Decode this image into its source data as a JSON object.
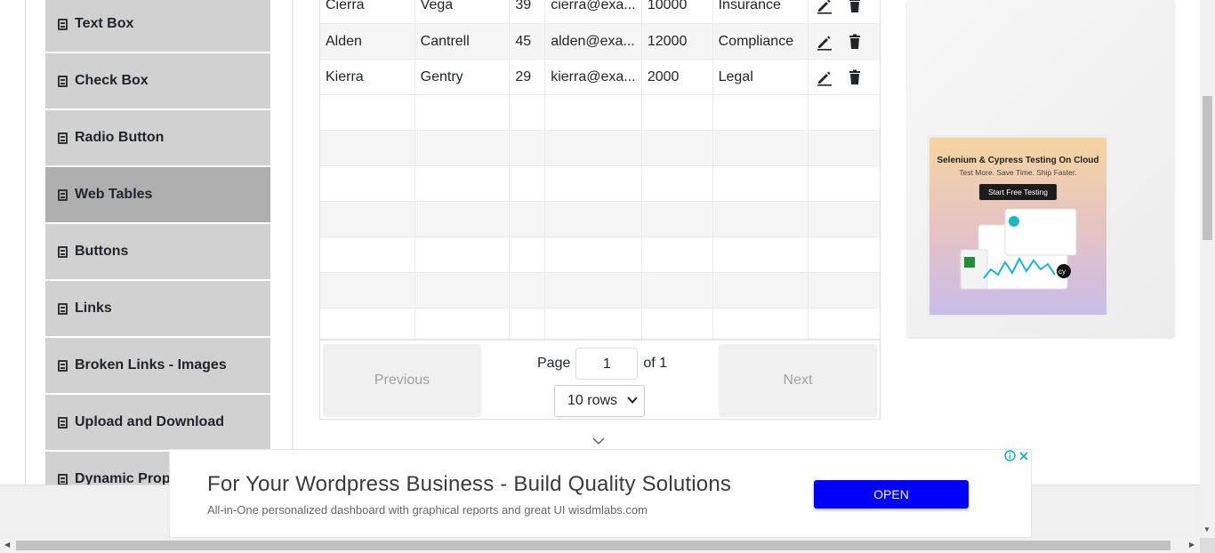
{
  "sidebar": {
    "items": [
      {
        "label": "Text Box"
      },
      {
        "label": "Check Box"
      },
      {
        "label": "Radio Button"
      },
      {
        "label": "Web Tables",
        "active": true
      },
      {
        "label": "Buttons"
      },
      {
        "label": "Links"
      },
      {
        "label": "Broken Links - Images"
      },
      {
        "label": "Upload and Download"
      },
      {
        "label": "Dynamic Prop"
      }
    ]
  },
  "table": {
    "rows": [
      {
        "first": "Cierra",
        "last": "Vega",
        "age": "39",
        "email": "cierra@exa...",
        "salary": "10000",
        "department": "Insurance"
      },
      {
        "first": "Alden",
        "last": "Cantrell",
        "age": "45",
        "email": "alden@exa...",
        "salary": "12000",
        "department": "Compliance"
      },
      {
        "first": "Kierra",
        "last": "Gentry",
        "age": "29",
        "email": "kierra@exa...",
        "salary": "2000",
        "department": "Legal"
      }
    ],
    "empty_rows": 7,
    "actions": [
      "edit-icon",
      "delete-icon"
    ]
  },
  "pagination": {
    "previous_label": "Previous",
    "next_label": "Next",
    "page_label": "Page",
    "page_value": "1",
    "of_label": "of 1",
    "rows_select": "10 rows"
  },
  "right_ad": {
    "title": "Selenium & Cypress Testing On Cloud",
    "subtitle": "Test More. Save Time. Ship Faster.",
    "button": "Start Free Testing"
  },
  "banner": {
    "title": "For Your Wordpress Business - Build Quality Solutions",
    "subtitle": "All-in-One personalized dashboard with graphical reports and great UI wisdmlabs.com",
    "open_label": "OPEN"
  },
  "colors": {
    "sidebar_bg": "#d1d1d1",
    "sidebar_active_bg": "#afafaf",
    "banner_button": "#0000ff"
  }
}
